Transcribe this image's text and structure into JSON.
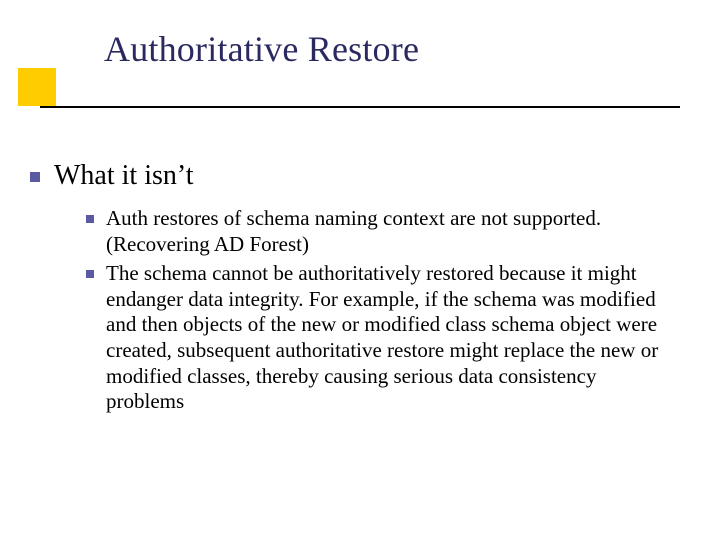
{
  "title": "Authoritative Restore",
  "body": {
    "heading": "What it isn’t",
    "items": [
      "Auth restores of schema naming context are not supported. (Recovering AD Forest)",
      "The schema cannot be authoritatively restored because it might endanger data integrity. For example, if the schema was modified and then objects of the new or modified class schema object were created, subsequent authoritative restore might replace the new or modified classes, thereby causing serious data consistency problems"
    ]
  }
}
